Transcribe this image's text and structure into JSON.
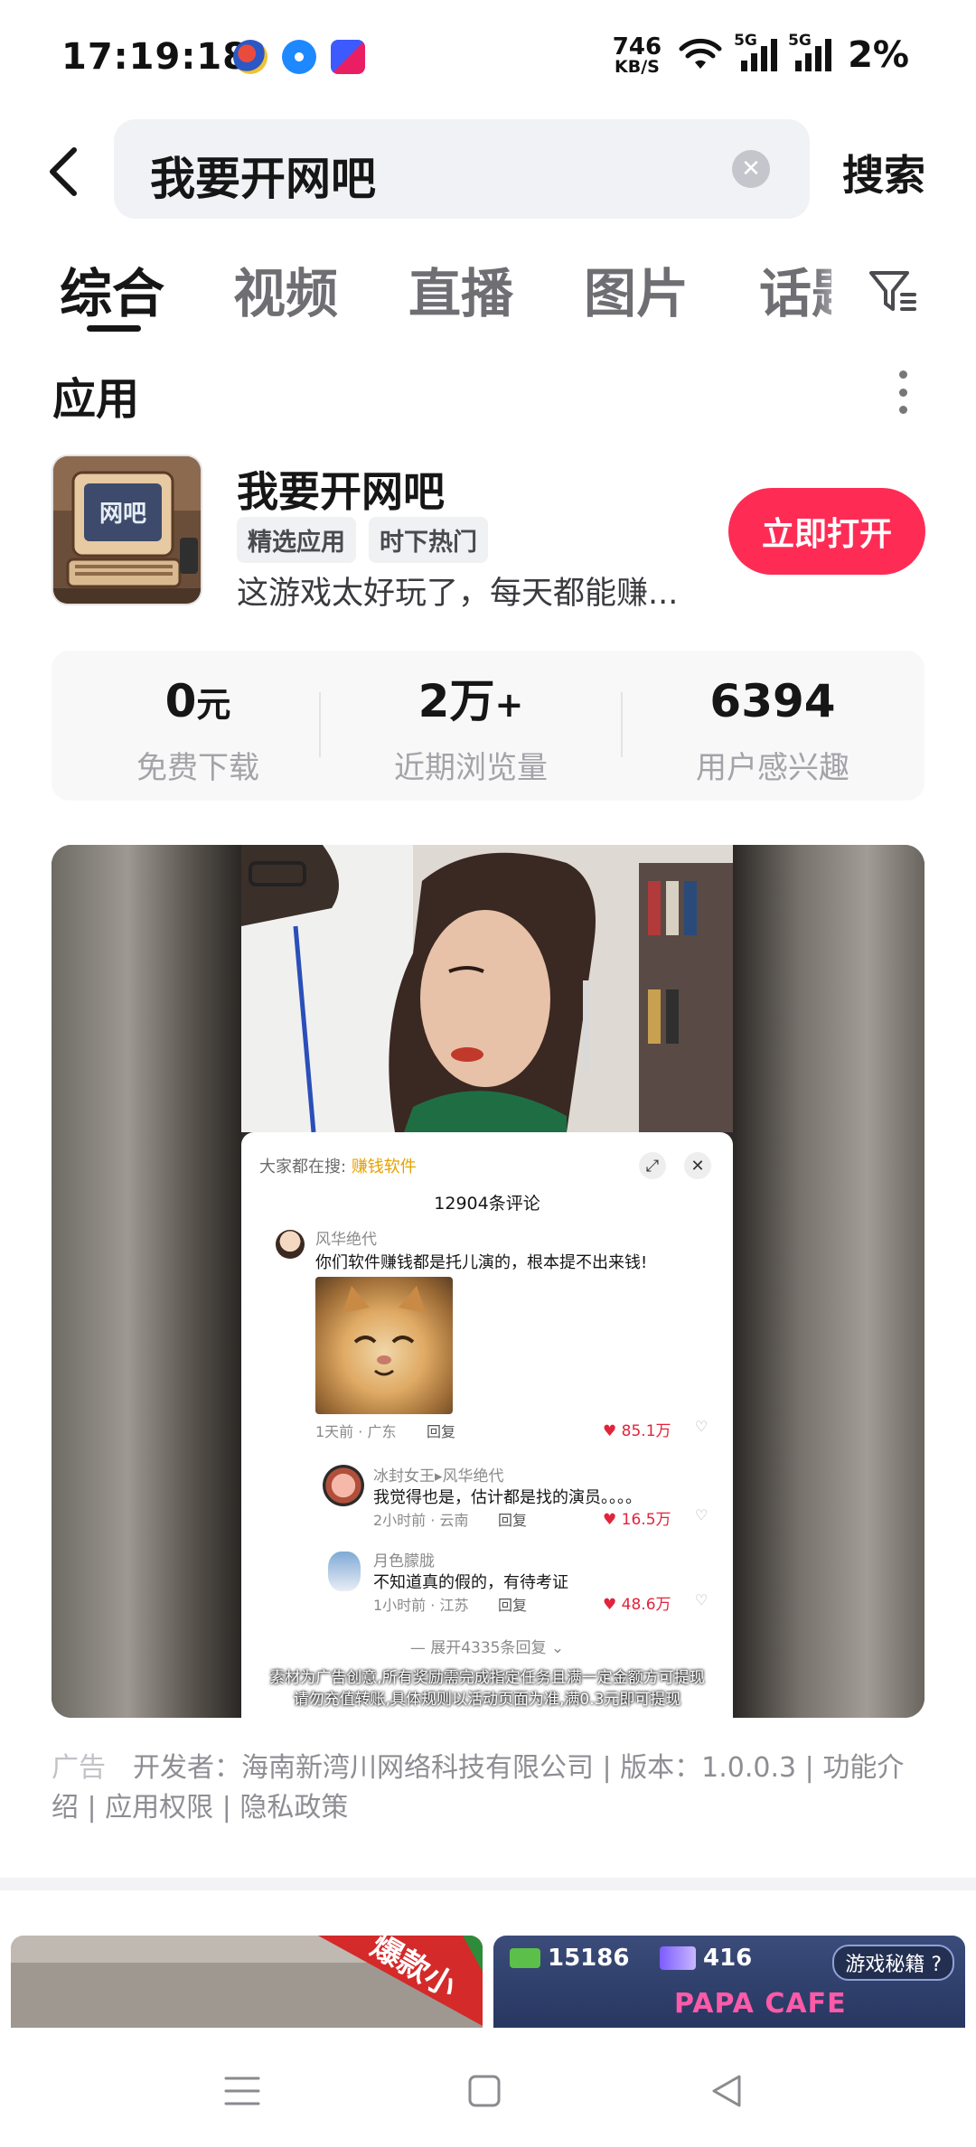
{
  "status_bar": {
    "time": "17:19:18",
    "speed_value": "746",
    "speed_unit": "KB/S",
    "net1": "5G",
    "net2": "5G",
    "battery": "2%"
  },
  "search": {
    "query": "我要开网吧",
    "search_label": "搜索"
  },
  "tabs": [
    {
      "label": "综合",
      "active": true
    },
    {
      "label": "视频",
      "active": false
    },
    {
      "label": "直播",
      "active": false
    },
    {
      "label": "图片",
      "active": false
    },
    {
      "label": "话题",
      "active": false
    }
  ],
  "section": {
    "title": "应用"
  },
  "app": {
    "name": "我要开网吧",
    "icon_text": "网吧",
    "tags": [
      "精选应用",
      "时下热门"
    ],
    "description": "这游戏太好玩了，每天都能赚...",
    "open_label": "立即打开"
  },
  "stats": [
    {
      "value": "0",
      "unit": "元",
      "label": "免费下载"
    },
    {
      "value": "2万",
      "unit": "+",
      "label": "近期浏览量"
    },
    {
      "value": "6394",
      "unit": "",
      "label": "用户感兴趣"
    }
  ],
  "video": {
    "hot_search_prefix": "大家都在搜:",
    "hot_search_term": "赚钱软件",
    "comment_count": "12904条评论",
    "comments": [
      {
        "user": "风华绝代",
        "text": "你们软件赚钱都是托儿演的，根本提不出来钱!",
        "meta": "1天前 · 广东",
        "reply": "回复",
        "likes": "85.1万"
      },
      {
        "user": "冰封女王▸风华绝代",
        "text": "我觉得也是，估计都是找的演员。。。。",
        "meta": "2小时前 · 云南",
        "reply": "回复",
        "likes": "16.5万"
      },
      {
        "user": "月色朦胧",
        "text": "不知道真的假的，有待考证",
        "meta": "1小时前 · 江苏",
        "reply": "回复",
        "likes": "48.6万"
      }
    ],
    "expand": "展开4335条回复",
    "disclaimer_line1": "素材为广告创意,所有奖励需完成指定任务且满一定金额方可提现",
    "disclaimer_line2": "请勿充值转账,具体规则以活动页面为准,满0.3元即可提现"
  },
  "ad_info": {
    "label": "广告",
    "text": "开发者：海南新湾川网络科技有限公司 | 版本：1.0.0.3 | 功能介绍 | 应用权限 | 隐私政策"
  },
  "feed": {
    "left_banner_text": "爆款小",
    "right_coins": "15186",
    "right_gems": "416",
    "right_chip": "游戏秘籍",
    "right_title": "PAPA CAFE"
  },
  "colors": {
    "accent": "#fe2c55",
    "like": "#e0243b",
    "hot_term": "#e6a100"
  }
}
